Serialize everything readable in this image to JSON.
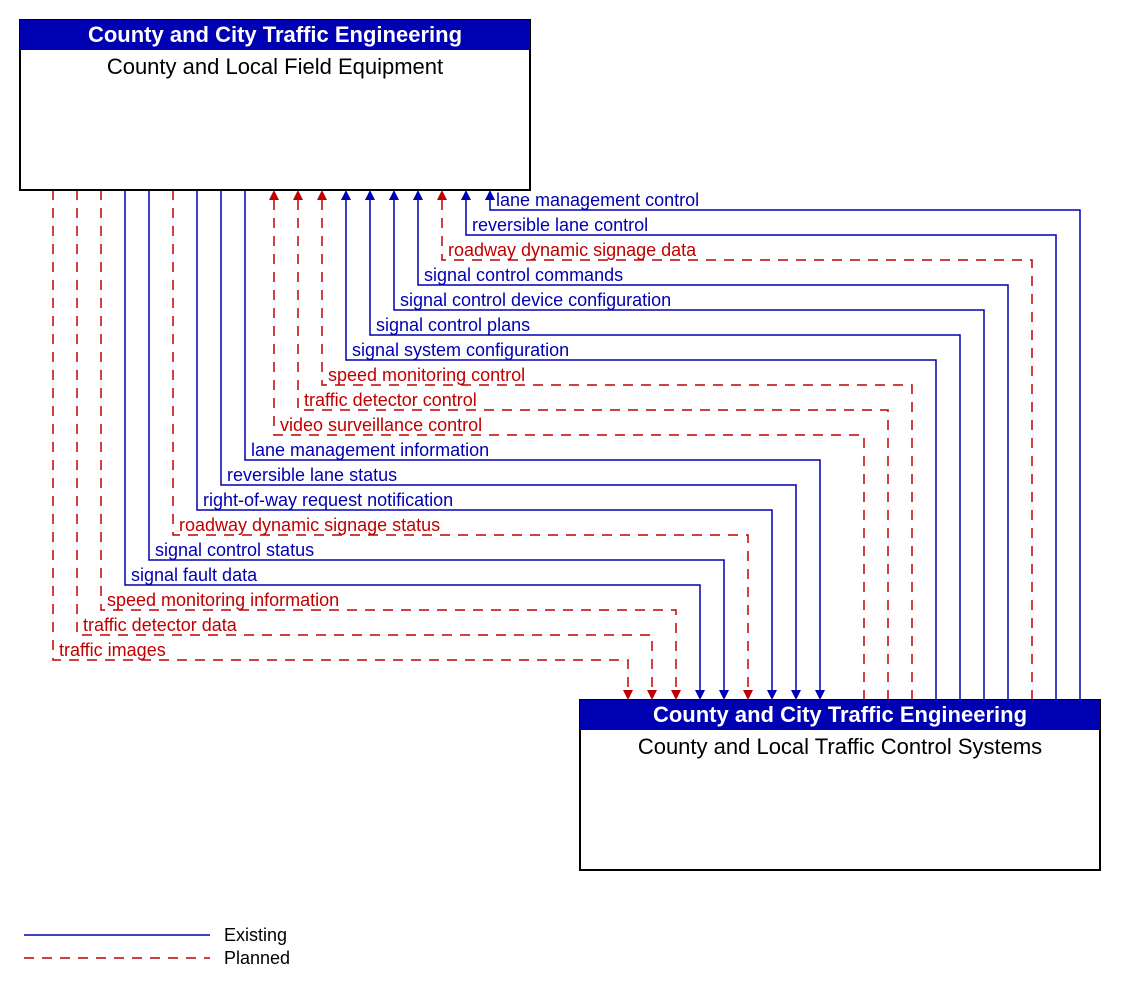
{
  "colors": {
    "existing": "#0000b3",
    "planned": "#c00000",
    "header_bg": "#0000b3",
    "header_fg": "#ffffff"
  },
  "legend": {
    "existing": "Existing",
    "planned": "Planned"
  },
  "boxes": {
    "top": {
      "header": "County and City Traffic Engineering",
      "title": "County and Local Field Equipment"
    },
    "bottom": {
      "header": "County and City Traffic Engineering",
      "title": "County and Local Traffic Control Systems"
    }
  },
  "flows_to_top": [
    {
      "label": "lane management control",
      "status": "existing"
    },
    {
      "label": "reversible lane control",
      "status": "existing"
    },
    {
      "label": "roadway dynamic signage data",
      "status": "planned"
    },
    {
      "label": "signal control commands",
      "status": "existing"
    },
    {
      "label": "signal control device configuration",
      "status": "existing"
    },
    {
      "label": "signal control plans",
      "status": "existing"
    },
    {
      "label": "signal system configuration",
      "status": "existing"
    },
    {
      "label": "speed monitoring control",
      "status": "planned"
    },
    {
      "label": "traffic detector control",
      "status": "planned"
    },
    {
      "label": "video surveillance control",
      "status": "planned"
    }
  ],
  "flows_to_bottom": [
    {
      "label": "lane management information",
      "status": "existing"
    },
    {
      "label": "reversible lane status",
      "status": "existing"
    },
    {
      "label": "right-of-way request notification",
      "status": "existing"
    },
    {
      "label": "roadway dynamic signage status",
      "status": "planned"
    },
    {
      "label": "signal control status",
      "status": "existing"
    },
    {
      "label": "signal fault data",
      "status": "existing"
    },
    {
      "label": "speed monitoring information",
      "status": "planned"
    },
    {
      "label": "traffic detector data",
      "status": "planned"
    },
    {
      "label": "traffic images",
      "status": "planned"
    }
  ]
}
